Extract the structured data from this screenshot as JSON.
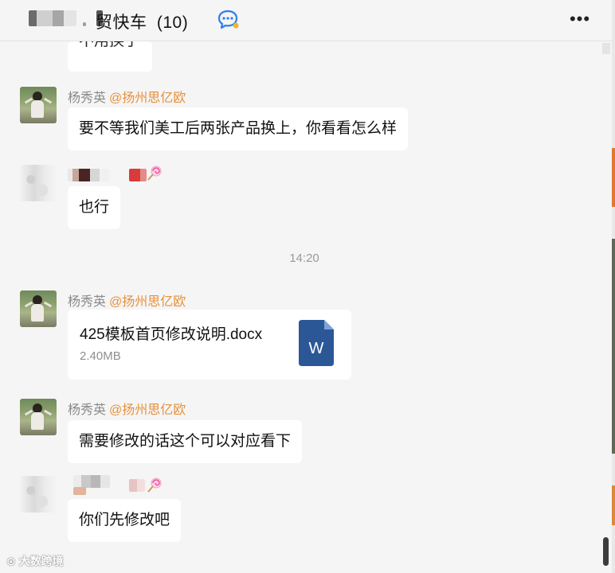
{
  "header": {
    "title": "贸快车",
    "member_count": "(10)"
  },
  "messages": {
    "partial_text": "不用换了",
    "m1": {
      "sender": "杨秀英",
      "mention": "@扬州思亿欧",
      "text": "要不等我们美工后两张产品换上，你看看怎么样"
    },
    "m2": {
      "text": "也行"
    },
    "timestamp": "14:20",
    "m3": {
      "sender": "杨秀英",
      "mention": "@扬州思亿欧",
      "file_name": "425模板首页修改说明.docx",
      "file_size": "2.40MB",
      "file_icon_letter": "W"
    },
    "m4": {
      "sender": "杨秀英",
      "mention": "@扬州思亿欧",
      "text": "需要修改的话这个可以对应看下"
    },
    "m5": {
      "text": "你们先修改吧"
    }
  },
  "watermark": "大数跨境",
  "icons": {
    "chat": "chat-bubble-icon",
    "more": "more-icon",
    "file": "word-doc-icon",
    "lollipop": "lollipop-emoji-icon"
  },
  "colors": {
    "mention": "#e6913a",
    "bubble": "#ffffff",
    "background": "#f5f5f5",
    "word_blue": "#2b5797"
  }
}
